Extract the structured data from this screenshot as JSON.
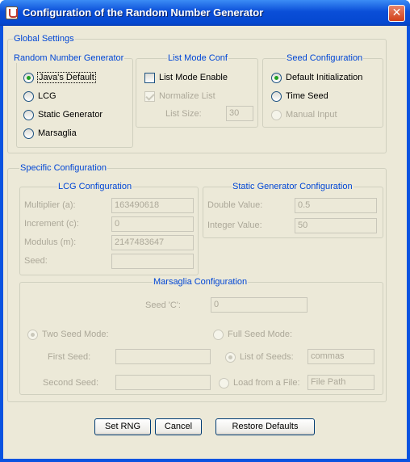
{
  "window": {
    "title": "Configuration of the Random Number Generator",
    "close_glyph": "✕"
  },
  "global": {
    "title": "Global Settings",
    "rng": {
      "title": "Random Number Generator",
      "options": [
        {
          "label": "Java's Default",
          "selected": true
        },
        {
          "label": "LCG",
          "selected": false
        },
        {
          "label": "Static Generator",
          "selected": false
        },
        {
          "label": "Marsaglia",
          "selected": false
        }
      ]
    },
    "list_mode": {
      "title": "List Mode Conf",
      "enable_label": "List Mode Enable",
      "normalize_label": "Normalize List",
      "size_label": "List Size:",
      "size_value": "30"
    },
    "seed": {
      "title": "Seed Configuration",
      "options": [
        {
          "label": "Default Initialization",
          "selected": true
        },
        {
          "label": "Time Seed",
          "selected": false
        },
        {
          "label": "Manual Input",
          "selected": false
        }
      ]
    }
  },
  "specific": {
    "title": "Specific Configuration",
    "lcg": {
      "title": "LCG Configuration",
      "multiplier_label": "Multiplier (a):",
      "multiplier_value": "163490618",
      "increment_label": "Increment (c):",
      "increment_value": "0",
      "modulus_label": "Modulus (m):",
      "modulus_value": "2147483647",
      "seed_label": "Seed:",
      "seed_value": ""
    },
    "static": {
      "title": "Static Generator Configuration",
      "double_label": "Double Value:",
      "double_value": "0.5",
      "integer_label": "Integer Value:",
      "integer_value": "50"
    },
    "marsaglia": {
      "title": "Marsaglia Configuration",
      "seed_c_label": "Seed 'C':",
      "seed_c_value": "0",
      "two_seed_label": "Two Seed Mode:",
      "full_seed_label": "Full Seed Mode:",
      "first_seed_label": "First Seed:",
      "first_seed_value": "",
      "second_seed_label": "Second Seed:",
      "second_seed_value": "",
      "list_seeds_label": "List of Seeds:",
      "list_seeds_value": "commas",
      "load_file_label": "Load from a File:",
      "file_path_value": "File Path"
    }
  },
  "buttons": {
    "set_rng": "Set RNG",
    "cancel": "Cancel",
    "restore": "Restore Defaults"
  }
}
